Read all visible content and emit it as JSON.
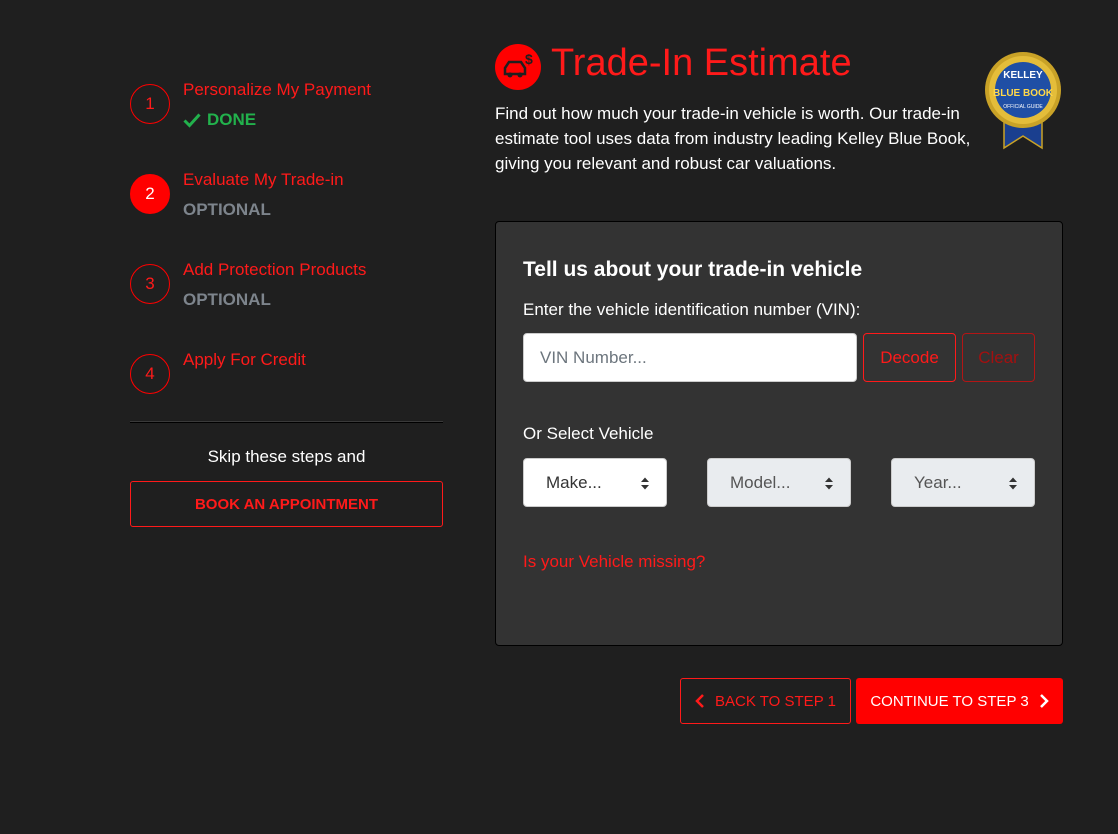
{
  "stepper": {
    "steps": [
      {
        "number": "1",
        "title": "Personalize My Payment",
        "status": "DONE"
      },
      {
        "number": "2",
        "title": "Evaluate My Trade-in",
        "status": "OPTIONAL"
      },
      {
        "number": "3",
        "title": "Add Protection Products",
        "status": "OPTIONAL"
      },
      {
        "number": "4",
        "title": "Apply For Credit",
        "status": ""
      }
    ],
    "skip_text": "Skip these steps and",
    "book_button": "BOOK AN APPOINTMENT"
  },
  "header": {
    "title": "Trade-In Estimate",
    "intro": "Find out how much your trade-in vehicle is worth. Our trade-in estimate tool uses data from industry leading Kelley Blue Book, giving you relevant and robust car valuations.",
    "logo_text": {
      "top": "KELLEY",
      "main": "BLUE BOOK",
      "bottom": "OFFICIAL GUIDE"
    }
  },
  "card": {
    "title": "Tell us about your trade-in vehicle",
    "vin_label": "Enter the vehicle identification number (VIN):",
    "vin_placeholder": "VIN Number...",
    "vin_value": "",
    "decode_button": "Decode",
    "clear_button": "Clear",
    "or_label": "Or Select Vehicle",
    "selects": {
      "make": "Make...",
      "model": "Model...",
      "year": "Year..."
    },
    "missing_link": "Is your Vehicle missing?"
  },
  "nav": {
    "back_button": "BACK TO STEP 1",
    "next_button": "CONTINUE TO STEP 3"
  },
  "colors": {
    "accent": "#ff0000",
    "background": "#1f1f1f",
    "card": "#333333",
    "done": "#22b14c",
    "muted": "#7d848c"
  },
  "icons": [
    "check-icon",
    "car-dollar-icon",
    "chevron-left-icon",
    "chevron-right-icon",
    "select-arrows-icon"
  ]
}
